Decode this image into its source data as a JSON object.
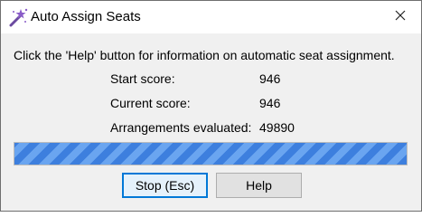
{
  "window": {
    "title": "Auto Assign Seats",
    "icon": "magic-wand-icon",
    "close_icon": "close-icon"
  },
  "dialog": {
    "info_text": "Click the 'Help' button for information on automatic seat assignment.",
    "rows": [
      {
        "label": "Start score:",
        "value": "946"
      },
      {
        "label": "Current score:",
        "value": "946"
      },
      {
        "label": "Arrangements evaluated:",
        "value": "49890"
      }
    ],
    "progress_fraction": 1.0
  },
  "buttons": {
    "stop_label": "Stop (Esc)",
    "help_label": "Help"
  },
  "colors": {
    "progress_dark": "#3d7fde",
    "progress_light": "#6aa5f0",
    "focus_border": "#0078d7"
  }
}
